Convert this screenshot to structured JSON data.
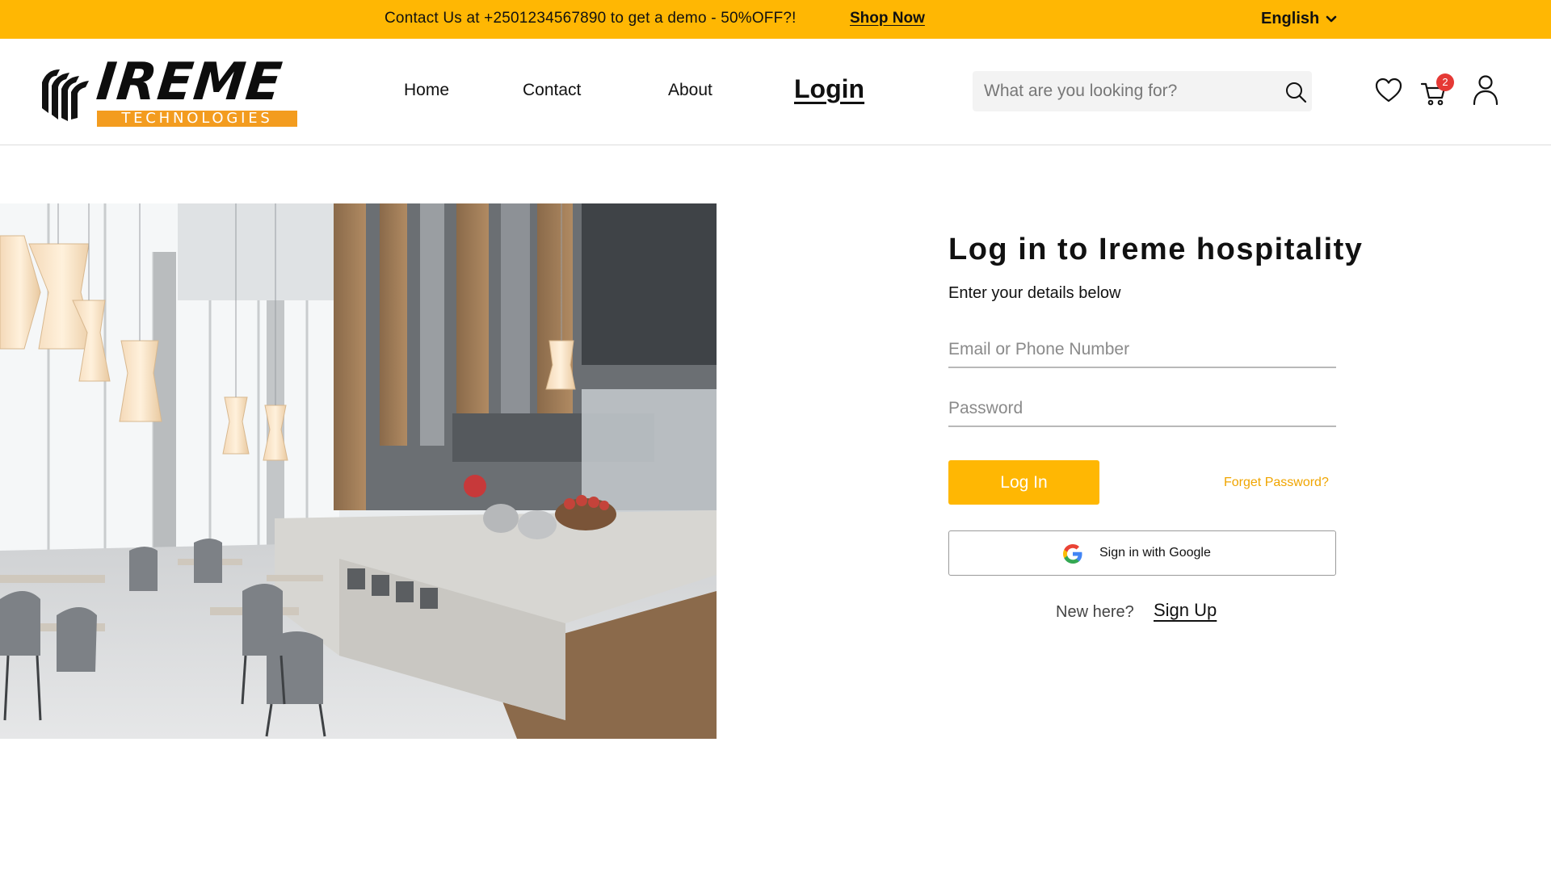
{
  "topbar": {
    "promo_text": "Contact Us at +2501234567890 to get a demo - 50%OFF?!",
    "shop_now": "Shop Now",
    "language": "English"
  },
  "brand": {
    "name": "IREME",
    "tagline": "TECHNOLOGIES",
    "accent_color": "#F39C1F"
  },
  "nav": {
    "home": "Home",
    "contact": "Contact",
    "about": "About",
    "login": "Login"
  },
  "search": {
    "placeholder": "What are you looking for?"
  },
  "cart": {
    "count": "2"
  },
  "hero": {
    "icon": "restaurant-interior-photo"
  },
  "login_form": {
    "title": "Log in to Ireme hospitality",
    "subtitle": "Enter your details below",
    "email_placeholder": "Email or Phone Number",
    "password_placeholder": "Password",
    "login_button": "Log In",
    "forgot_password": "Forget Password?",
    "google_button": "Sign in with Google",
    "new_here": "New here?",
    "sign_up": "Sign Up"
  },
  "colors": {
    "primary": "#FFB703",
    "badge": "#E53935"
  }
}
